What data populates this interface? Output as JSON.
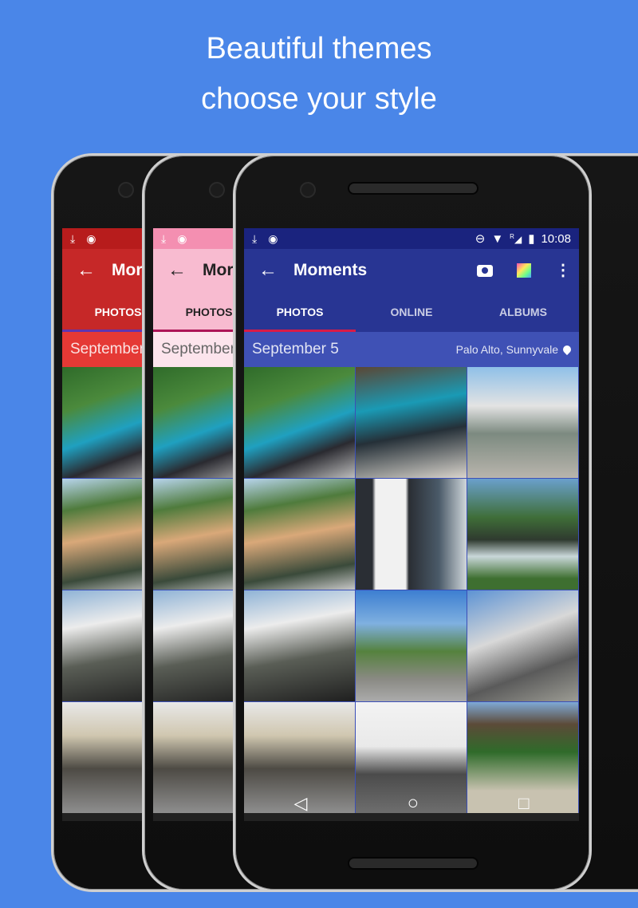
{
  "headline": {
    "line1": "Beautiful themes",
    "line2": "choose your style"
  },
  "themes": [
    {
      "name": "red",
      "statusbar": "#b71c1c",
      "primary": "#c62828",
      "accent_bar": "#e53935"
    },
    {
      "name": "pink",
      "statusbar": "#f48fb1",
      "primary": "#f8bbd0",
      "accent_bar": "#fce4ec"
    },
    {
      "name": "indigo",
      "statusbar": "#1a237e",
      "primary": "#283593",
      "accent_bar": "#3f51b5"
    }
  ],
  "tab_indicator_color": "#d81b47",
  "statusbar": {
    "time": "10:08",
    "left_icons": [
      "download-icon",
      "android-icon"
    ],
    "right_icons": [
      "do-not-disturb-icon",
      "wifi-icon",
      "cell-signal-icon",
      "battery-charging-icon"
    ],
    "roaming_label": "R"
  },
  "appbar": {
    "back_glyph": "←",
    "title": "Moments",
    "title_truncated": "Mor",
    "actions": [
      "camera-icon",
      "theme-palette-icon",
      "overflow-menu-icon"
    ]
  },
  "tabs": [
    {
      "label": "PHOTOS",
      "active": true
    },
    {
      "label": "ONLINE",
      "active": false
    },
    {
      "label": "ALBUMS",
      "active": false
    }
  ],
  "section": {
    "date": "September 5",
    "date_truncated": "September",
    "location": "Palo Alto, Sunnyvale"
  },
  "photos": [
    {
      "desc": "storefront with trees"
    },
    {
      "desc": "teal storefront"
    },
    {
      "desc": "walkway between buildings"
    },
    {
      "desc": "plaza under tree"
    },
    {
      "desc": "fashion poster on wall"
    },
    {
      "desc": "fountain with plants"
    },
    {
      "desc": "people walking by shops"
    },
    {
      "desc": "street with trees"
    },
    {
      "desc": "building with kiosk"
    },
    {
      "desc": "covered arcade"
    },
    {
      "desc": "mall entrance"
    },
    {
      "desc": "plaza with benches"
    }
  ],
  "navbar": {
    "back": "◁",
    "home": "○",
    "recents": "□"
  }
}
